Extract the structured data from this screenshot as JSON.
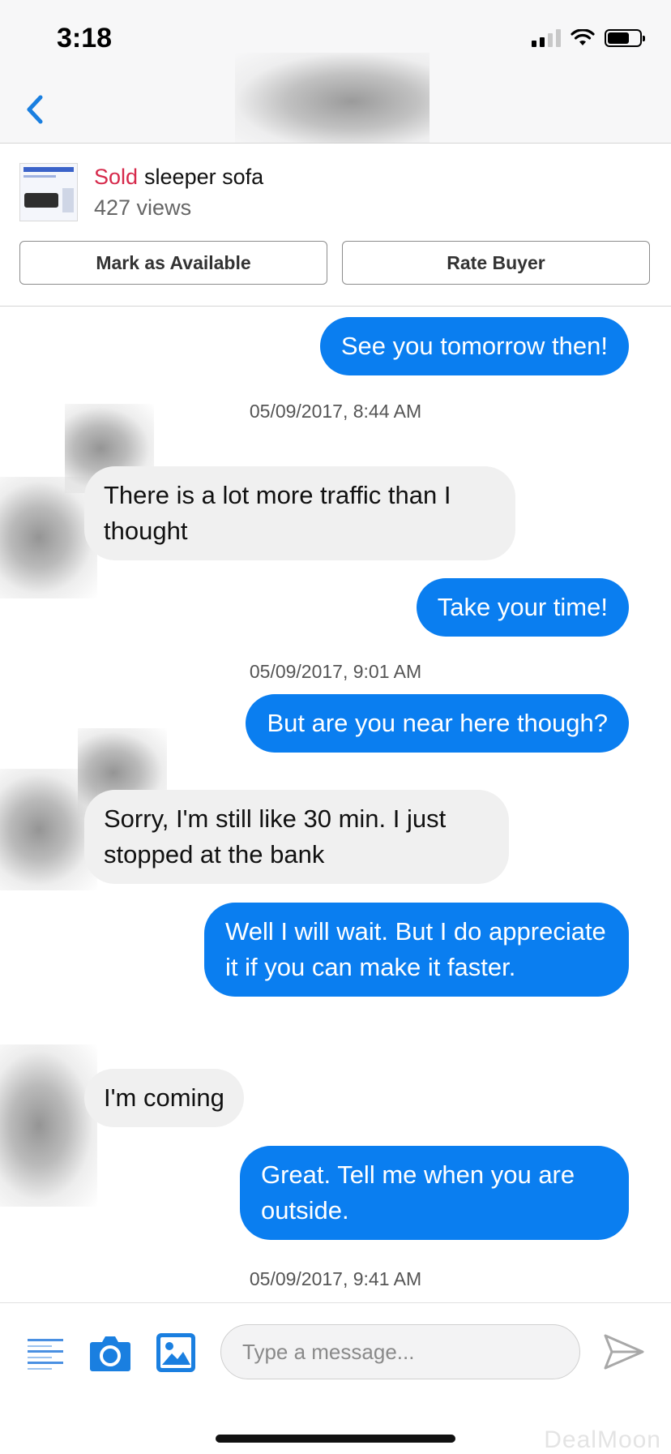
{
  "status_bar": {
    "time": "3:18"
  },
  "nav": {
    "back_icon": "chevron-left-icon"
  },
  "listing": {
    "status": "Sold",
    "title": "sleeper sofa",
    "views": "427 views",
    "mark_available_label": "Mark as Available",
    "rate_buyer_label": "Rate Buyer"
  },
  "messages": [
    {
      "direction": "outgoing",
      "text": "See you tomorrow then!"
    },
    {
      "type": "timestamp",
      "text": "05/09/2017, 8:44 AM"
    },
    {
      "direction": "incoming",
      "text": "There is a lot more traffic than I thought"
    },
    {
      "direction": "outgoing",
      "text": "Take your time!"
    },
    {
      "type": "timestamp",
      "text": "05/09/2017, 9:01 AM"
    },
    {
      "direction": "outgoing",
      "text": "But are you near here though?"
    },
    {
      "direction": "incoming",
      "text": "Sorry, I'm still like 30 min. I just stopped at the bank"
    },
    {
      "direction": "outgoing",
      "text": "Well I will wait. But I do appreciate it if you can make it faster."
    },
    {
      "direction": "incoming",
      "text": "I'm coming"
    },
    {
      "direction": "outgoing",
      "text": "Great. Tell me when you are outside."
    },
    {
      "type": "timestamp",
      "text": "05/09/2017, 9:41 AM"
    }
  ],
  "composer": {
    "placeholder": "Type a message...",
    "value": "",
    "icons": [
      "menu-icon",
      "camera-icon",
      "photo-icon",
      "send-icon"
    ]
  },
  "watermark": "DealMoon",
  "colors": {
    "outgoing_bubble": "#0a7ef0",
    "incoming_bubble": "#f0f0f0",
    "accent_blue": "#1a7fe0",
    "sold_red": "#d6294b"
  }
}
